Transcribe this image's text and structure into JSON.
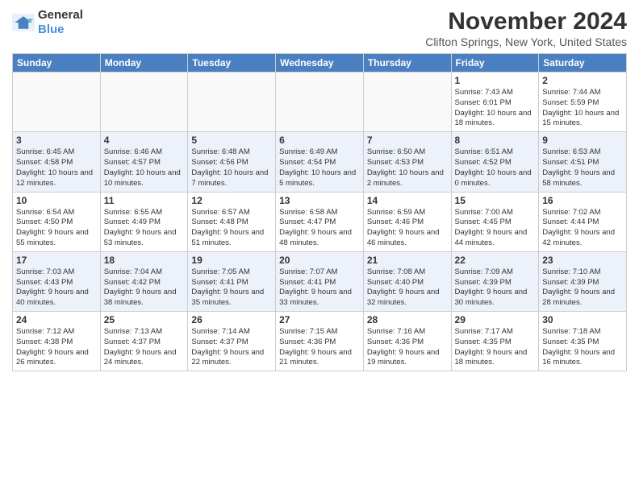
{
  "header": {
    "logo_general": "General",
    "logo_blue": "Blue",
    "month_title": "November 2024",
    "location": "Clifton Springs, New York, United States"
  },
  "days_of_week": [
    "Sunday",
    "Monday",
    "Tuesday",
    "Wednesday",
    "Thursday",
    "Friday",
    "Saturday"
  ],
  "weeks": [
    [
      {
        "day": "",
        "info": ""
      },
      {
        "day": "",
        "info": ""
      },
      {
        "day": "",
        "info": ""
      },
      {
        "day": "",
        "info": ""
      },
      {
        "day": "",
        "info": ""
      },
      {
        "day": "1",
        "info": "Sunrise: 7:43 AM\nSunset: 6:01 PM\nDaylight: 10 hours and 18 minutes."
      },
      {
        "day": "2",
        "info": "Sunrise: 7:44 AM\nSunset: 5:59 PM\nDaylight: 10 hours and 15 minutes."
      }
    ],
    [
      {
        "day": "3",
        "info": "Sunrise: 6:45 AM\nSunset: 4:58 PM\nDaylight: 10 hours and 12 minutes."
      },
      {
        "day": "4",
        "info": "Sunrise: 6:46 AM\nSunset: 4:57 PM\nDaylight: 10 hours and 10 minutes."
      },
      {
        "day": "5",
        "info": "Sunrise: 6:48 AM\nSunset: 4:56 PM\nDaylight: 10 hours and 7 minutes."
      },
      {
        "day": "6",
        "info": "Sunrise: 6:49 AM\nSunset: 4:54 PM\nDaylight: 10 hours and 5 minutes."
      },
      {
        "day": "7",
        "info": "Sunrise: 6:50 AM\nSunset: 4:53 PM\nDaylight: 10 hours and 2 minutes."
      },
      {
        "day": "8",
        "info": "Sunrise: 6:51 AM\nSunset: 4:52 PM\nDaylight: 10 hours and 0 minutes."
      },
      {
        "day": "9",
        "info": "Sunrise: 6:53 AM\nSunset: 4:51 PM\nDaylight: 9 hours and 58 minutes."
      }
    ],
    [
      {
        "day": "10",
        "info": "Sunrise: 6:54 AM\nSunset: 4:50 PM\nDaylight: 9 hours and 55 minutes."
      },
      {
        "day": "11",
        "info": "Sunrise: 6:55 AM\nSunset: 4:49 PM\nDaylight: 9 hours and 53 minutes."
      },
      {
        "day": "12",
        "info": "Sunrise: 6:57 AM\nSunset: 4:48 PM\nDaylight: 9 hours and 51 minutes."
      },
      {
        "day": "13",
        "info": "Sunrise: 6:58 AM\nSunset: 4:47 PM\nDaylight: 9 hours and 48 minutes."
      },
      {
        "day": "14",
        "info": "Sunrise: 6:59 AM\nSunset: 4:46 PM\nDaylight: 9 hours and 46 minutes."
      },
      {
        "day": "15",
        "info": "Sunrise: 7:00 AM\nSunset: 4:45 PM\nDaylight: 9 hours and 44 minutes."
      },
      {
        "day": "16",
        "info": "Sunrise: 7:02 AM\nSunset: 4:44 PM\nDaylight: 9 hours and 42 minutes."
      }
    ],
    [
      {
        "day": "17",
        "info": "Sunrise: 7:03 AM\nSunset: 4:43 PM\nDaylight: 9 hours and 40 minutes."
      },
      {
        "day": "18",
        "info": "Sunrise: 7:04 AM\nSunset: 4:42 PM\nDaylight: 9 hours and 38 minutes."
      },
      {
        "day": "19",
        "info": "Sunrise: 7:05 AM\nSunset: 4:41 PM\nDaylight: 9 hours and 35 minutes."
      },
      {
        "day": "20",
        "info": "Sunrise: 7:07 AM\nSunset: 4:41 PM\nDaylight: 9 hours and 33 minutes."
      },
      {
        "day": "21",
        "info": "Sunrise: 7:08 AM\nSunset: 4:40 PM\nDaylight: 9 hours and 32 minutes."
      },
      {
        "day": "22",
        "info": "Sunrise: 7:09 AM\nSunset: 4:39 PM\nDaylight: 9 hours and 30 minutes."
      },
      {
        "day": "23",
        "info": "Sunrise: 7:10 AM\nSunset: 4:39 PM\nDaylight: 9 hours and 28 minutes."
      }
    ],
    [
      {
        "day": "24",
        "info": "Sunrise: 7:12 AM\nSunset: 4:38 PM\nDaylight: 9 hours and 26 minutes."
      },
      {
        "day": "25",
        "info": "Sunrise: 7:13 AM\nSunset: 4:37 PM\nDaylight: 9 hours and 24 minutes."
      },
      {
        "day": "26",
        "info": "Sunrise: 7:14 AM\nSunset: 4:37 PM\nDaylight: 9 hours and 22 minutes."
      },
      {
        "day": "27",
        "info": "Sunrise: 7:15 AM\nSunset: 4:36 PM\nDaylight: 9 hours and 21 minutes."
      },
      {
        "day": "28",
        "info": "Sunrise: 7:16 AM\nSunset: 4:36 PM\nDaylight: 9 hours and 19 minutes."
      },
      {
        "day": "29",
        "info": "Sunrise: 7:17 AM\nSunset: 4:35 PM\nDaylight: 9 hours and 18 minutes."
      },
      {
        "day": "30",
        "info": "Sunrise: 7:18 AM\nSunset: 4:35 PM\nDaylight: 9 hours and 16 minutes."
      }
    ]
  ]
}
